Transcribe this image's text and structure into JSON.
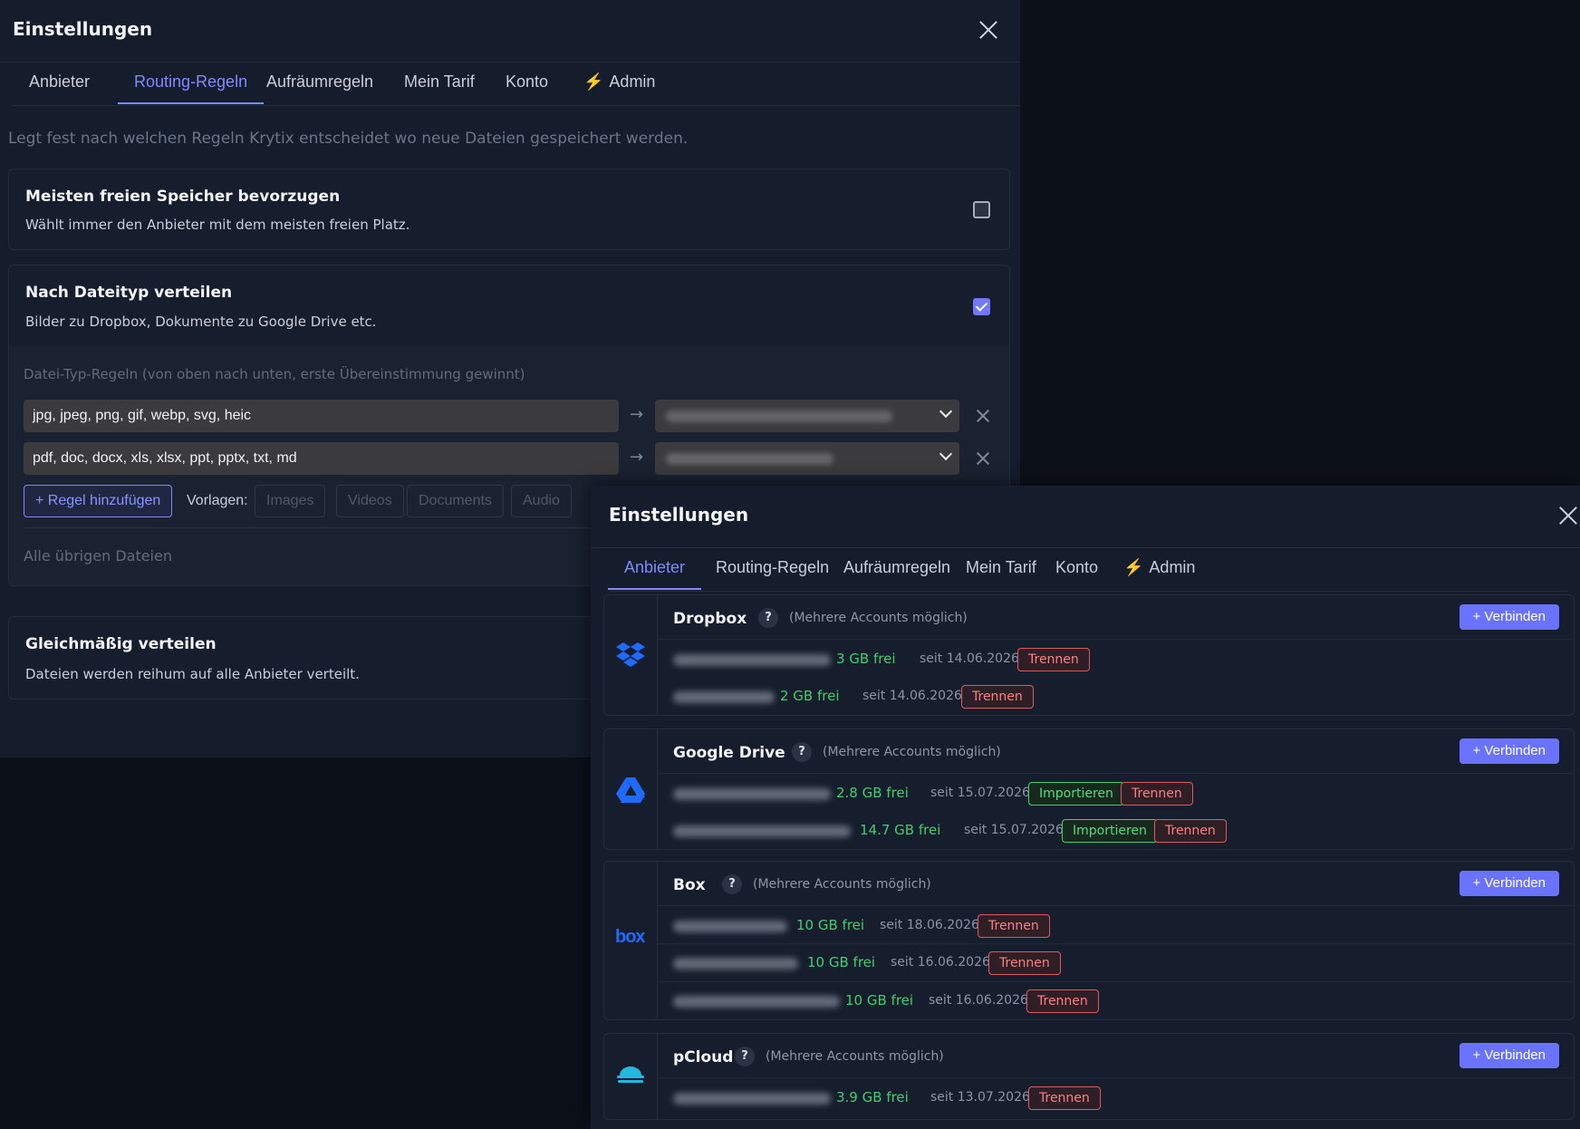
{
  "routing_window": {
    "title": "Einstellungen",
    "tabs": [
      "Anbieter",
      "Routing-Regeln",
      "Aufräumregeln",
      "Mein Tarif",
      "Konto",
      "Admin"
    ],
    "active_tab": "Routing-Regeln",
    "intro": "Legt fest nach welchen Regeln Krytix entscheidet wo neue Dateien gespeichert werden.",
    "options": [
      {
        "title": "Meisten freien Speicher bevorzugen",
        "desc": "Wählt immer den Anbieter mit dem meisten freien Platz.",
        "checked": false
      },
      {
        "title": "Nach Dateityp verteilen",
        "desc": "Bilder zu Dropbox, Dokumente zu Google Drive etc.",
        "checked": true
      }
    ],
    "filetype_rules": {
      "hint": "Datei-Typ-Regeln (von oben nach unten, erste Übereinstimmung gewinnt)",
      "rules": [
        {
          "extensions": "jpg, jpeg, png, gif, webp, svg, heic",
          "arrow": "→"
        },
        {
          "extensions": "pdf, doc, docx, xls, xlsx, ppt, pptx, txt, md",
          "arrow": "→"
        }
      ],
      "add_rule": "+ Regel hinzufügen",
      "templates_label": "Vorlagen:",
      "templates": [
        "Images",
        "Videos",
        "Documents",
        "Audio"
      ],
      "rest_label": "Alle übrigen Dateien"
    },
    "equal_option": {
      "title": "Gleichmäßig verteilen",
      "desc": "Dateien werden reihum auf alle Anbieter verteilt."
    }
  },
  "provider_window": {
    "title": "Einstellungen",
    "tabs": [
      "Anbieter",
      "Routing-Regeln",
      "Aufräumregeln",
      "Mein Tarif",
      "Konto",
      "Admin"
    ],
    "active_tab": "Anbieter",
    "multi_label": "(Mehrere Accounts möglich)",
    "help": "?",
    "connect_label": "+ Verbinden",
    "disconnect_label": "Trennen",
    "import_label": "Importieren",
    "providers": [
      {
        "name": "Dropbox",
        "icon": "dropbox-icon",
        "accounts": [
          {
            "free": "3 GB frei",
            "since": "seit 14.06.2026",
            "import": false
          },
          {
            "free": "2 GB frei",
            "since": "seit 14.06.2026",
            "import": false
          }
        ]
      },
      {
        "name": "Google Drive",
        "icon": "google-drive-icon",
        "accounts": [
          {
            "free": "2.8 GB frei",
            "since": "seit 15.07.2026",
            "import": true
          },
          {
            "free": "14.7 GB frei",
            "since": "seit 15.07.2026",
            "import": true
          }
        ]
      },
      {
        "name": "Box",
        "icon": "box-icon",
        "icon_text": "box",
        "accounts": [
          {
            "free": "10 GB frei",
            "since": "seit 18.06.2026",
            "import": false
          },
          {
            "free": "10 GB frei",
            "since": "seit 16.06.2026",
            "import": false
          },
          {
            "free": "10 GB frei",
            "since": "seit 16.06.2026",
            "import": false
          }
        ]
      },
      {
        "name": "pCloud",
        "icon": "pcloud-icon",
        "accounts": [
          {
            "free": "3.9 GB frei",
            "since": "seit 13.07.2026",
            "import": false
          }
        ]
      }
    ]
  },
  "colors": {
    "accent": "#8089ff",
    "button": "#6a73ff",
    "free": "#3fcf6d",
    "danger": "#e0585f",
    "bolt": "#f5b32c"
  }
}
